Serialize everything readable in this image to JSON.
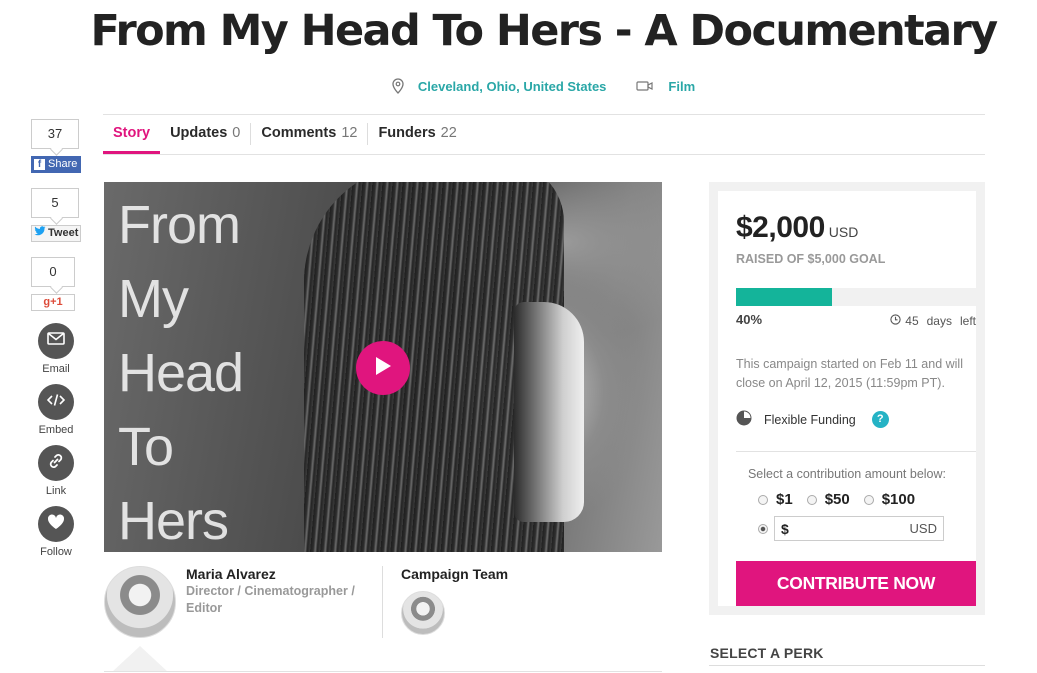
{
  "title": "From My Head To Hers - A Documentary",
  "meta": {
    "location": "Cleveland, Ohio, United States",
    "category": "Film"
  },
  "tabs": [
    {
      "label": "Story",
      "count": ""
    },
    {
      "label": "Updates",
      "count": "0"
    },
    {
      "label": "Comments",
      "count": "12"
    },
    {
      "label": "Funders",
      "count": "22"
    }
  ],
  "social": {
    "fb_count": "37",
    "fb_label": "Share",
    "tw_count": "5",
    "tw_label": "Tweet",
    "gp_count": "0",
    "gp_label": "g+1",
    "email_label": "Email",
    "embed_label": "Embed",
    "link_label": "Link",
    "follow_label": "Follow"
  },
  "video": {
    "title_lines": [
      "From",
      "My",
      "Head",
      "To",
      "Hers"
    ]
  },
  "creator": {
    "name": "Maria Alvarez",
    "role": "Director / Cinematographer / Editor",
    "team_title": "Campaign Team"
  },
  "campaign": {
    "raised": "$2,000",
    "currency": "USD",
    "goal_text": "RAISED OF $5,000 GOAL",
    "progress_fraction": 0.4,
    "percent_label": "40%",
    "days_number": "45",
    "days_label": "days",
    "days_suffix": "left",
    "dates_text": "This campaign started on Feb 11 and will close on April 12, 2015 (11:59pm PT).",
    "funding_type": "Flexible Funding",
    "help": "?",
    "contrib_label": "Select a contribution amount below:",
    "amounts": [
      "$1",
      "$50",
      "$100"
    ],
    "custom_prefix": "$",
    "custom_currency": "USD",
    "cta_label": "CONTRIBUTE NOW"
  },
  "perk_heading": "SELECT A PERK",
  "colors": {
    "accent": "#e0157e",
    "teal": "#2aa7a7",
    "progress": "#14b49a"
  }
}
